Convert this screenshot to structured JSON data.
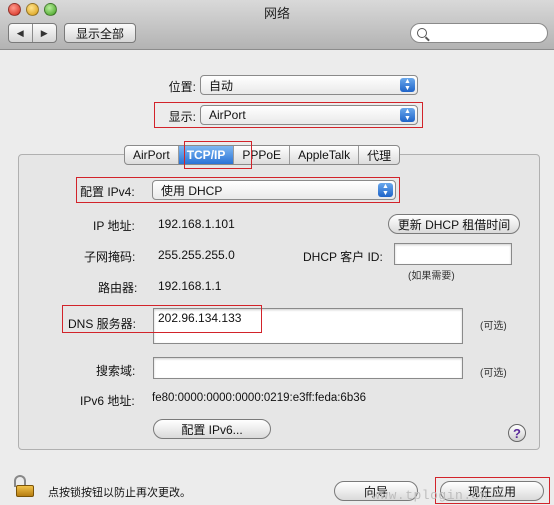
{
  "window": {
    "title": "网络"
  },
  "toolbar": {
    "back_icon": "◀",
    "forward_icon": "▶",
    "show_all_label": "显示全部",
    "search_placeholder": ""
  },
  "location": {
    "label": "位置:",
    "value": "自动"
  },
  "show": {
    "label": "显示:",
    "value": "AirPort"
  },
  "tabs": [
    {
      "label": "AirPort",
      "active": false
    },
    {
      "label": "TCP/IP",
      "active": true
    },
    {
      "label": "PPPoE",
      "active": false
    },
    {
      "label": "AppleTalk",
      "active": false
    },
    {
      "label": "代理",
      "active": false
    }
  ],
  "configure": {
    "label": "配置 IPv4:",
    "value": "使用 DHCP"
  },
  "ip": {
    "label": "IP 地址:",
    "value": "192.168.1.101"
  },
  "renew_button": "更新 DHCP 租借时间",
  "subnet": {
    "label": "子网掩码:",
    "value": "255.255.255.0"
  },
  "dhcp_client": {
    "label": "DHCP 客户 ID:",
    "value": "",
    "note": "(如果需要)"
  },
  "router": {
    "label": "路由器:",
    "value": "192.168.1.1"
  },
  "dns": {
    "label": "DNS 服务器:",
    "value": "202.96.134.133",
    "note": "(可选)"
  },
  "search_domains": {
    "label": "搜索域:",
    "value": "",
    "note": "(可选)"
  },
  "ipv6": {
    "label": "IPv6 地址:",
    "value": "fe80:0000:0000:0000:0219:e3ff:feda:6b36"
  },
  "configure_ipv6_button": "配置 IPv6...",
  "help_label": "?",
  "lock_text": "点按锁按钮以防止再次更改。",
  "assist_button": "向导",
  "apply_button": "现在应用",
  "watermark": "www.tplogin.cn",
  "colors": {
    "highlight": "#d2232a",
    "tab_active": "#2a73d6"
  }
}
